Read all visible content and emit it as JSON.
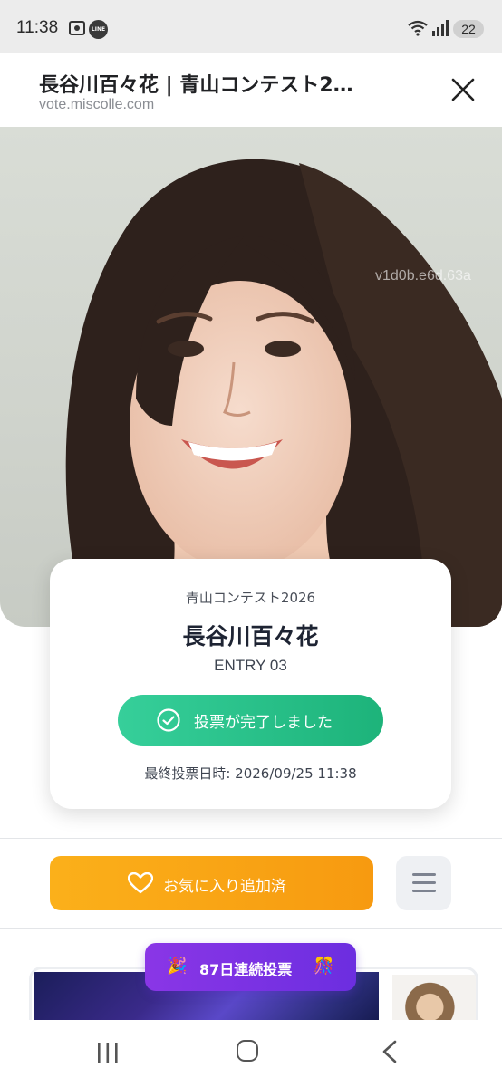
{
  "status_bar": {
    "time": "11:38",
    "line_badge": "LINE",
    "battery": "22"
  },
  "browser": {
    "title": "長谷川百々花 | 青山コンテスト2…",
    "url": "vote.miscolle.com"
  },
  "hero": {
    "watermark_1": "v1d0b.e6d.63a",
    "watermark_2": "v1d0b.e6d.63a"
  },
  "card": {
    "contest": "青山コンテスト2026",
    "name": "長谷川百々花",
    "entry": "ENTRY 03",
    "vote_button": "投票が完了しました",
    "last_vote": "最終投票日時: 2026/09/25 11:38"
  },
  "actions": {
    "favorite_label": "お気に入り追加済",
    "menu_icon": "hamburger-icon"
  },
  "streak": {
    "label": "87日連続投票",
    "left_emoji": "🎉",
    "right_emoji": "🎊"
  },
  "colors": {
    "vote_green": "#1db37a",
    "favorite_orange": "#f79a10",
    "streak_purple": "#7a32e4"
  }
}
